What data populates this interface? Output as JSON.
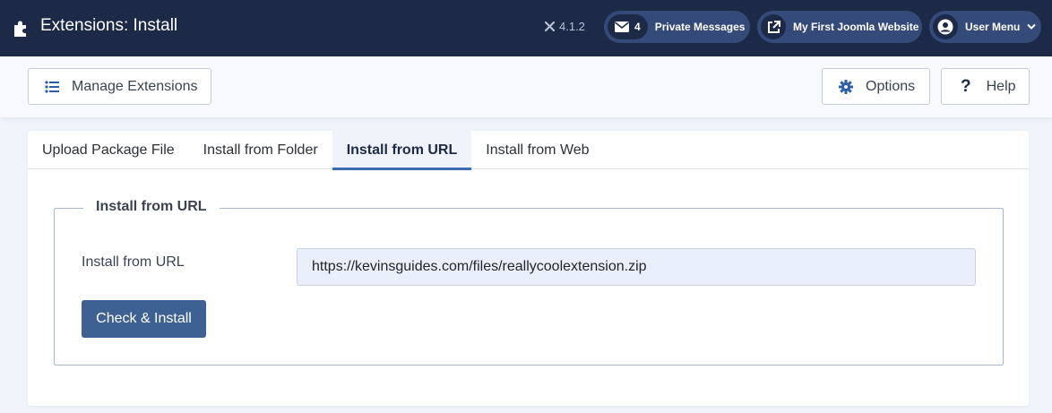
{
  "header": {
    "title": "Extensions: Install",
    "version": "4.1.2",
    "messages_count": "4",
    "messages_label": "Private Messages",
    "site_label": "My First Joomla Website",
    "user_menu_label": "User Menu"
  },
  "toolbar": {
    "manage_label": "Manage Extensions",
    "options_label": "Options",
    "help_label": "Help"
  },
  "tabs": [
    {
      "label": "Upload Package File"
    },
    {
      "label": "Install from Folder"
    },
    {
      "label": "Install from URL"
    },
    {
      "label": "Install from Web"
    }
  ],
  "form": {
    "legend": "Install from URL",
    "field_label": "Install from URL",
    "url_value": "https://kevinsguides.com/files/reallycoolextension.zip",
    "submit_label": "Check & Install"
  },
  "colors": {
    "header_bg": "#1c2a47",
    "pill_bg": "#344a78",
    "accent": "#3d6ab4",
    "button_bg": "#3e6194"
  }
}
